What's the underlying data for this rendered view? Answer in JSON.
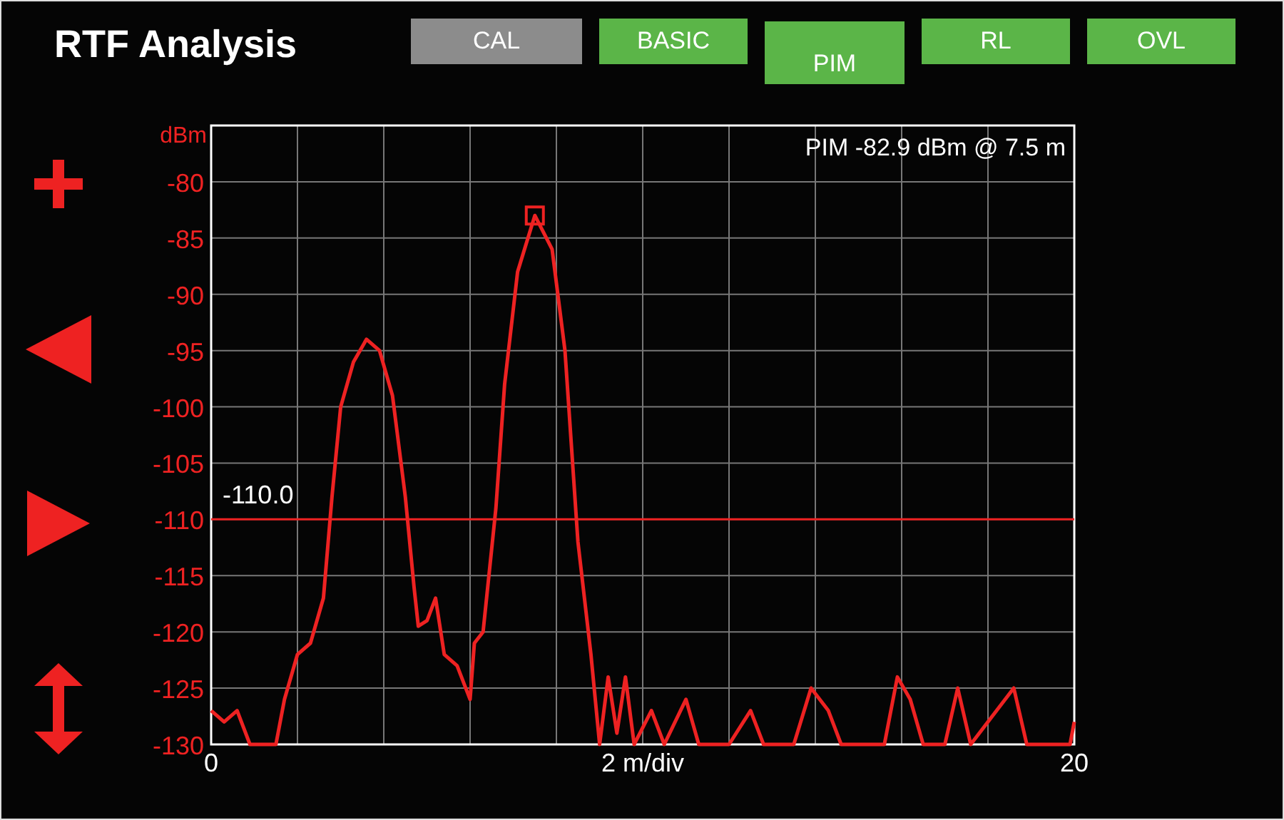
{
  "title": "RTF Analysis",
  "modes": [
    {
      "label": "CAL",
      "selected": false,
      "disabled": true
    },
    {
      "label": "BASIC",
      "selected": false,
      "disabled": false
    },
    {
      "label": "PIM",
      "selected": true,
      "disabled": false
    },
    {
      "label": "RL",
      "selected": false,
      "disabled": false
    },
    {
      "label": "OVL",
      "selected": false,
      "disabled": false
    }
  ],
  "side_controls": [
    {
      "kind": "plus"
    },
    {
      "kind": "left"
    },
    {
      "kind": "right"
    },
    {
      "kind": "updown"
    }
  ],
  "chart": {
    "readout": "PIM -82.9 dBm @ 7.5 m",
    "chart_data": {
      "type": "line",
      "ylabel": "dBm",
      "xlabel": "2 m/div",
      "x": [
        0,
        0.3,
        0.6,
        0.9,
        1.5,
        1.7,
        2.0,
        2.3,
        2.6,
        2.8,
        3.0,
        3.3,
        3.6,
        3.9,
        4.2,
        4.5,
        4.7,
        4.8,
        5.0,
        5.2,
        5.4,
        5.7,
        6.0,
        6.1,
        6.3,
        6.6,
        6.8,
        7.1,
        7.5,
        7.9,
        8.2,
        8.5,
        8.8,
        9.0,
        9.2,
        9.4,
        9.6,
        9.8,
        10.2,
        10.5,
        11.0,
        11.3,
        12.0,
        12.5,
        12.8,
        13.5,
        13.9,
        14.3,
        14.6,
        15.6,
        15.9,
        16.2,
        16.5,
        17.0,
        17.3,
        17.6,
        18.6,
        18.9,
        19.9,
        20
      ],
      "series": [
        {
          "color": "#ee2222",
          "values": [
            -127,
            -128,
            -127,
            -130,
            -130,
            -126,
            -122,
            -121,
            -117,
            -108,
            -100,
            -96,
            -94,
            -95,
            -99,
            -108,
            -116,
            -119.5,
            -119,
            -117,
            -122,
            -123,
            -126,
            -121,
            -120,
            -109,
            -98,
            -88,
            -83,
            -86,
            -95,
            -112,
            -122,
            -130,
            -124,
            -129,
            -124,
            -130,
            -127,
            -130,
            -126,
            -130,
            -130,
            -127,
            -130,
            -130,
            -125,
            -127,
            -130,
            -130,
            -124,
            -126,
            -130,
            -130,
            -125,
            -130,
            -125,
            -130,
            -130,
            -128
          ]
        }
      ],
      "xlim": [
        0,
        20
      ],
      "ylim": [
        -130,
        -75
      ],
      "xticks": [
        0,
        20
      ],
      "grid": true,
      "yticks": [
        -80,
        -85,
        -90,
        -95,
        -100,
        -105,
        -110,
        -115,
        -120,
        -125,
        -130
      ],
      "ref_lines": [
        {
          "axis": "y",
          "value": -110,
          "label": "-110.0"
        }
      ]
    }
  }
}
